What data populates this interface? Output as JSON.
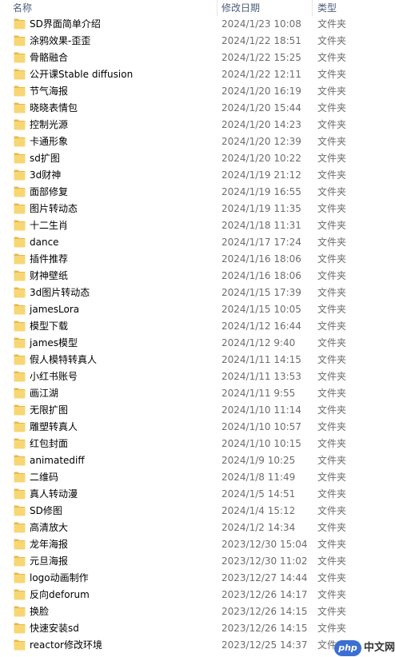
{
  "header": {
    "name_label": "名称",
    "date_label": "修改日期",
    "type_label": "类型"
  },
  "colors": {
    "folder_fill": "#f7d774",
    "folder_tab": "#e8b84a",
    "secondary_text": "#6d6d6d",
    "header_text": "#4c607a"
  },
  "rows": [
    {
      "name": "SD界面简单介绍",
      "date": "2024/1/23 10:08",
      "type": "文件夹"
    },
    {
      "name": "涂鸦效果-歪歪",
      "date": "2024/1/22 18:51",
      "type": "文件夹"
    },
    {
      "name": "骨骼融合",
      "date": "2024/1/22 15:25",
      "type": "文件夹"
    },
    {
      "name": "公开课Stable diffusion",
      "date": "2024/1/22 12:11",
      "type": "文件夹"
    },
    {
      "name": "节气海报",
      "date": "2024/1/20 16:19",
      "type": "文件夹"
    },
    {
      "name": "晓晓表情包",
      "date": "2024/1/20 15:44",
      "type": "文件夹"
    },
    {
      "name": "控制光源",
      "date": "2024/1/20 14:23",
      "type": "文件夹"
    },
    {
      "name": "卡通形象",
      "date": "2024/1/20 12:39",
      "type": "文件夹"
    },
    {
      "name": "sd扩图",
      "date": "2024/1/20 10:22",
      "type": "文件夹"
    },
    {
      "name": "3d财神",
      "date": "2024/1/19 21:12",
      "type": "文件夹"
    },
    {
      "name": "面部修复",
      "date": "2024/1/19 16:55",
      "type": "文件夹"
    },
    {
      "name": "图片转动态",
      "date": "2024/1/19 11:35",
      "type": "文件夹"
    },
    {
      "name": "十二生肖",
      "date": "2024/1/18 11:31",
      "type": "文件夹"
    },
    {
      "name": "dance",
      "date": "2024/1/17 17:24",
      "type": "文件夹"
    },
    {
      "name": "插件推荐",
      "date": "2024/1/16 18:06",
      "type": "文件夹"
    },
    {
      "name": "财神壁纸",
      "date": "2024/1/16 18:06",
      "type": "文件夹"
    },
    {
      "name": "3d图片转动态",
      "date": "2024/1/15 17:39",
      "type": "文件夹"
    },
    {
      "name": "jamesLora",
      "date": "2024/1/15 10:05",
      "type": "文件夹"
    },
    {
      "name": "模型下载",
      "date": "2024/1/12 16:44",
      "type": "文件夹"
    },
    {
      "name": "james模型",
      "date": "2024/1/12 9:40",
      "type": "文件夹"
    },
    {
      "name": "假人模特转真人",
      "date": "2024/1/11 14:15",
      "type": "文件夹"
    },
    {
      "name": "小红书账号",
      "date": "2024/1/11 13:53",
      "type": "文件夹"
    },
    {
      "name": "画江湖",
      "date": "2024/1/11 9:55",
      "type": "文件夹"
    },
    {
      "name": "无限扩图",
      "date": "2024/1/10 11:14",
      "type": "文件夹"
    },
    {
      "name": "雕塑转真人",
      "date": "2024/1/10 10:57",
      "type": "文件夹"
    },
    {
      "name": "红包封面",
      "date": "2024/1/10 10:15",
      "type": "文件夹"
    },
    {
      "name": "animatediff",
      "date": "2024/1/9 10:25",
      "type": "文件夹"
    },
    {
      "name": "二维码",
      "date": "2024/1/8 11:49",
      "type": "文件夹"
    },
    {
      "name": "真人转动漫",
      "date": "2024/1/5 14:51",
      "type": "文件夹"
    },
    {
      "name": "SD修图",
      "date": "2024/1/4 15:12",
      "type": "文件夹"
    },
    {
      "name": "高清放大",
      "date": "2024/1/2 14:34",
      "type": "文件夹"
    },
    {
      "name": "龙年海报",
      "date": "2023/12/30 15:04",
      "type": "文件夹"
    },
    {
      "name": "元旦海报",
      "date": "2023/12/30 11:02",
      "type": "文件夹"
    },
    {
      "name": "logo动画制作",
      "date": "2023/12/27 14:44",
      "type": "文件夹"
    },
    {
      "name": "反向deforum",
      "date": "2023/12/26 14:17",
      "type": "文件夹"
    },
    {
      "name": "换脸",
      "date": "2023/12/26 14:15",
      "type": "文件夹"
    },
    {
      "name": "快速安装sd",
      "date": "2023/12/26 14:15",
      "type": "文件夹"
    },
    {
      "name": "reactor修改环境",
      "date": "2023/12/25 14:37",
      "type": "文件夹"
    }
  ],
  "watermark": {
    "badge": "php",
    "text": "中文网"
  }
}
